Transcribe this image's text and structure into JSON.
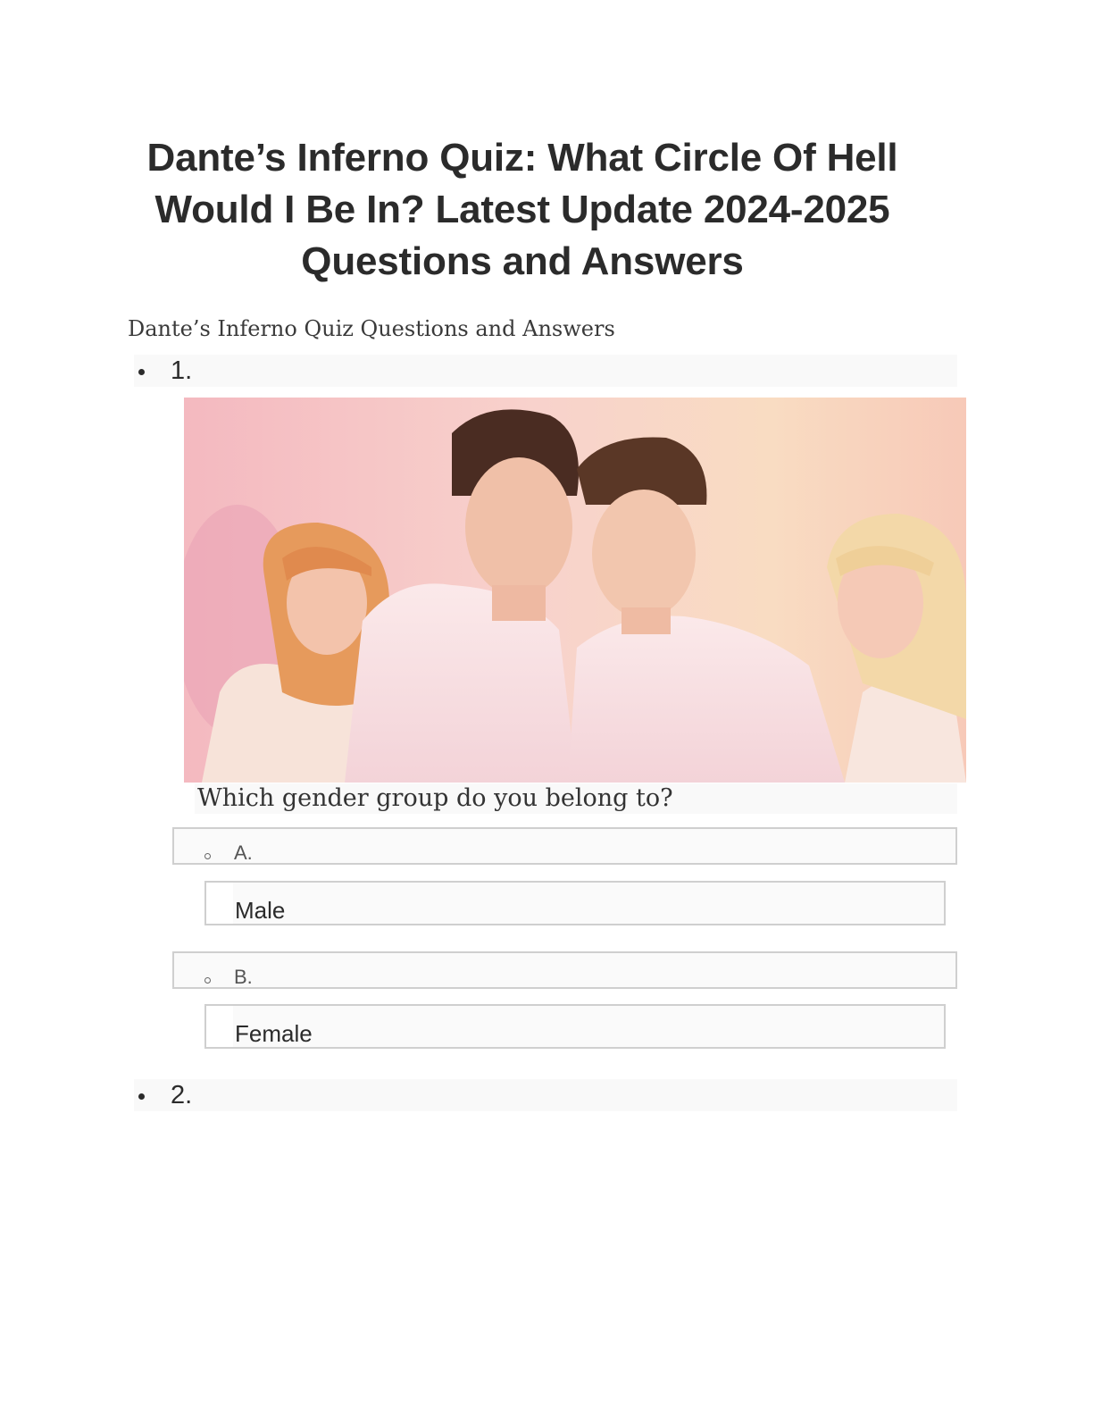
{
  "document": {
    "title": "Dante’s Inferno Quiz: What Circle Of Hell Would I Be In? Latest Update 2024-2025 Questions and Answers",
    "subtitle": "Dante’s Inferno Quiz Questions and Answers"
  },
  "questions": [
    {
      "number": "1.",
      "image": "group-photo",
      "text": "Which gender group do you belong to?",
      "options": [
        {
          "letter": "A.",
          "answer": "Male"
        },
        {
          "letter": "B.",
          "answer": "Female"
        }
      ]
    },
    {
      "number": "2."
    }
  ],
  "colors": {
    "text": "#2b2b2b",
    "row_background": "#f9f9f9",
    "border": "#cfcfcf",
    "photo_background": "#f6c9c6"
  }
}
